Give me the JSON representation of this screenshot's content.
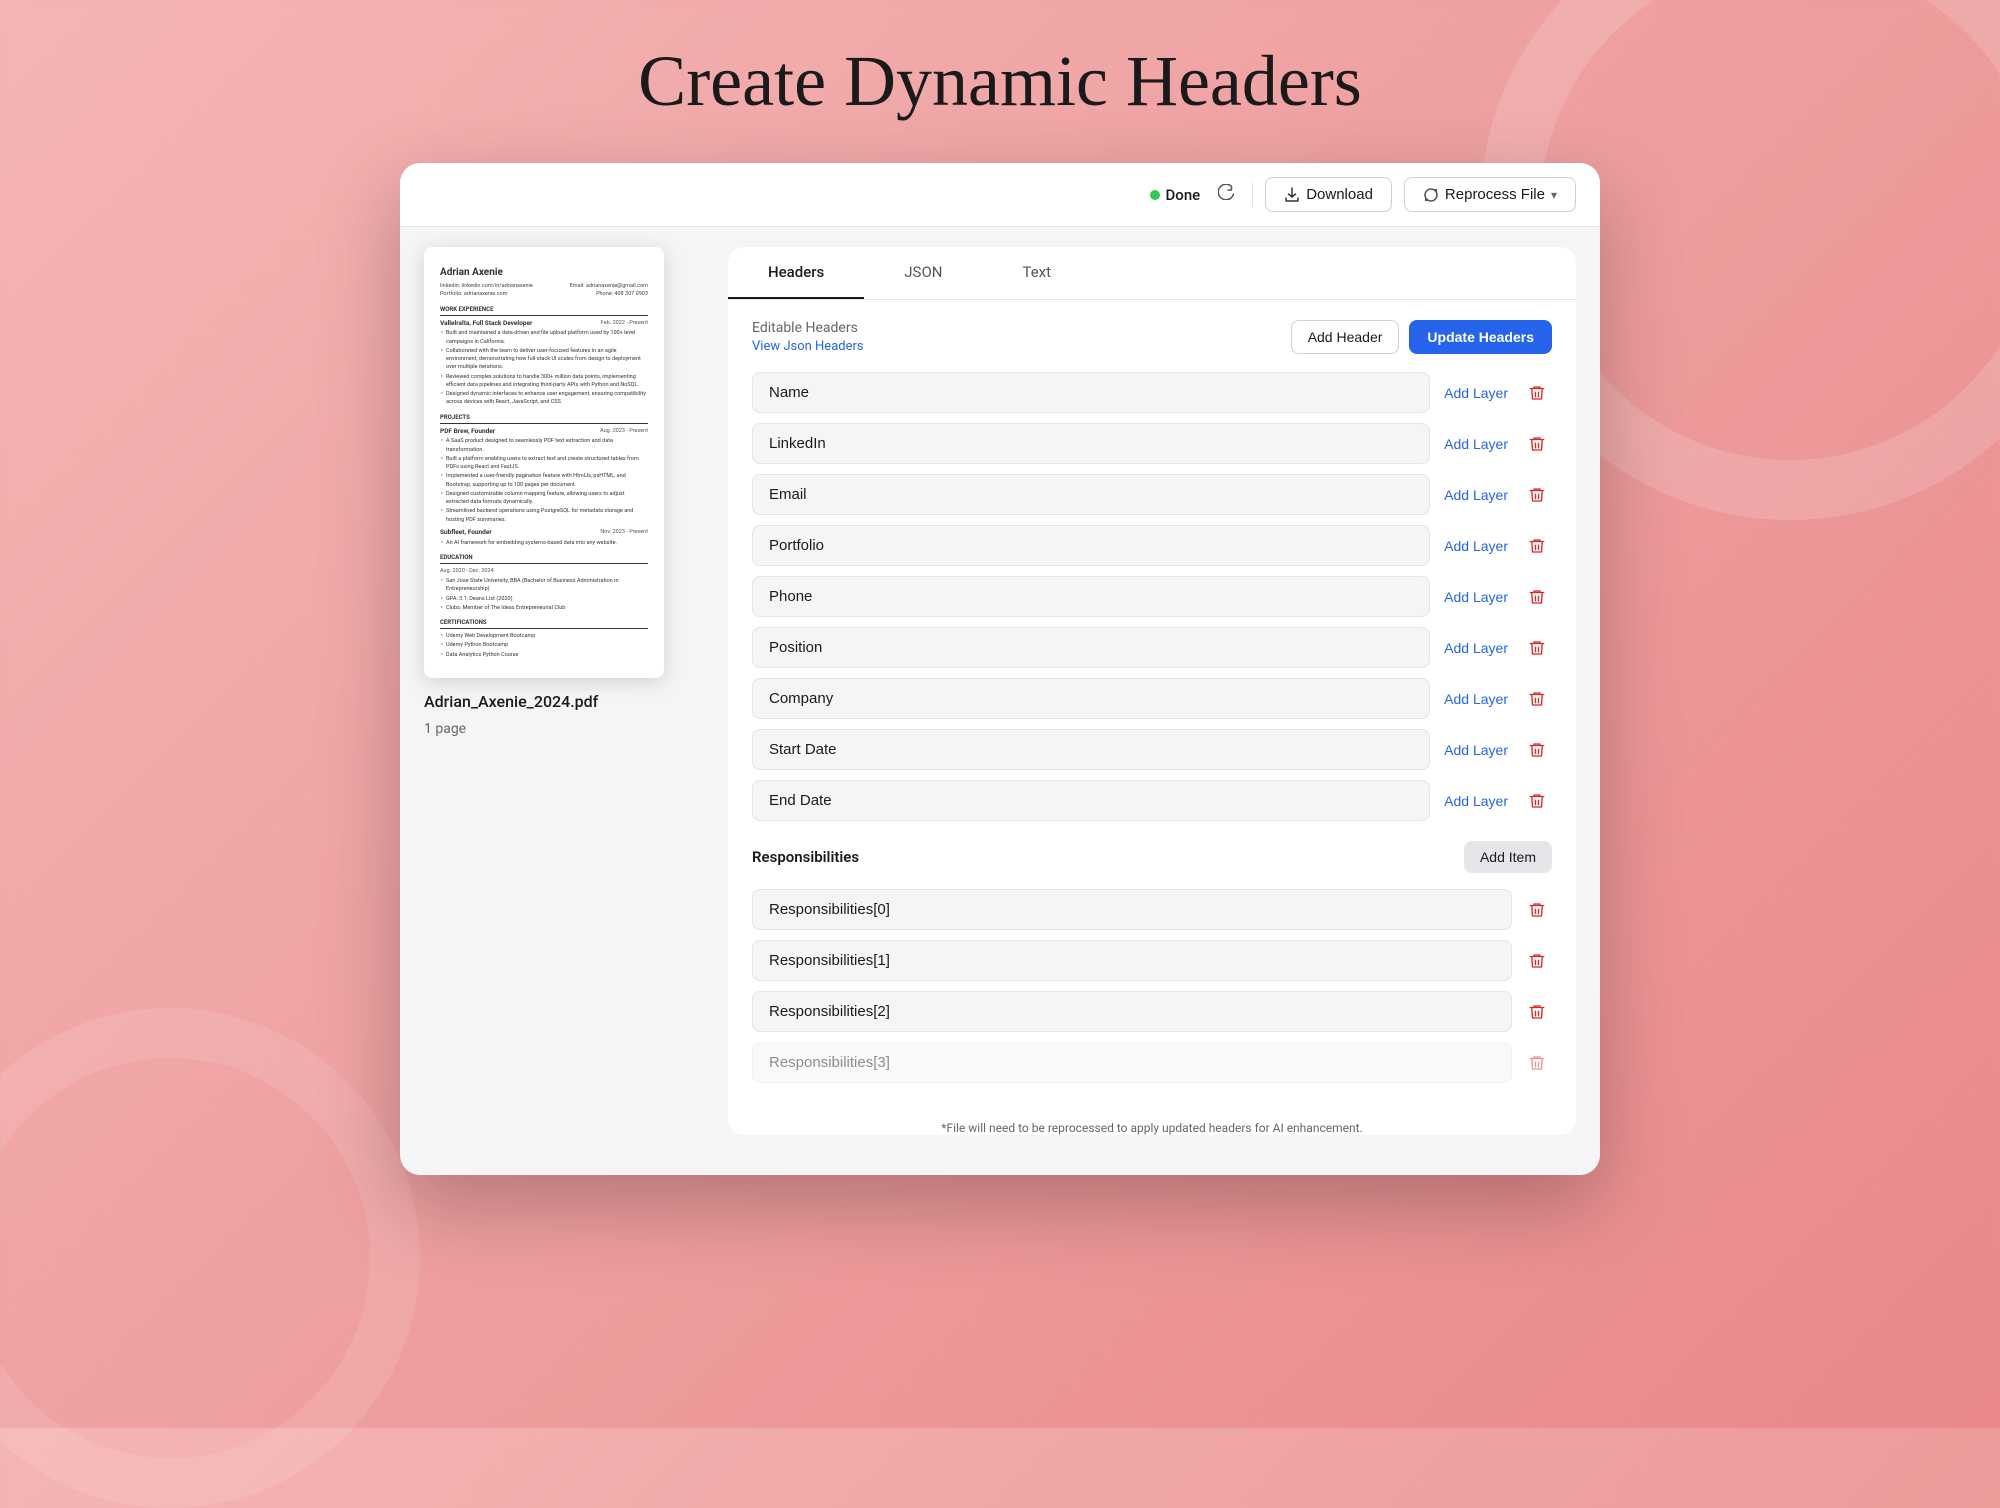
{
  "page": {
    "title": "Create Dynamic Headers"
  },
  "toolbar": {
    "status_label": "Done",
    "download_label": "Download",
    "reprocess_label": "Reprocess File"
  },
  "pdf": {
    "filename": "Adrian_Axenie_2024.pdf",
    "pages": "1 page",
    "preview": {
      "name": "Adrian Axenie",
      "linkedin": "linkedin: linkedin.com/in/adrianaxenie",
      "portfolio": "Portfolio: adrianaxenie.com",
      "email": "Email: adrianaxenie@gmail.com",
      "phone": "Phone: 408 307 0903",
      "work_section": "WORK EXPERIENCE",
      "job_title": "Vallelralta, Full Stack Developer",
      "date1": "Feb. 2022 - Present",
      "bullets": [
        "Built and maintained a data-driven and file upload platform used by 100+ level campaign in California.",
        "Collaborated with the team to deliver user-focused features in an agile environment, demonstrating how full-stack UI scales from design to deployment over multiple iterations.",
        "Reviewed complex solutions to handle 100+ million data points, implementing efficient data pipelines and integrating third-party APIs with Python and NoSQL.",
        "Designed dynamic interfaces to enhance user engagement, ensuring accessibility across devices with React, JavaScript, and CSS."
      ],
      "projects_section": "PROJECTS",
      "proj1_title": "PDF Brew, Founder",
      "proj1_date": "Aug. 2023 - Present",
      "education_section": "EDUCATION",
      "edu_date": "Aug. 2020 - Dec. 2024",
      "edu_text": "San Jose State University, BBA (Bachelor of Business Administration in Entrepreneurship)",
      "certifications_section": "CERTIFICATIONS"
    }
  },
  "tabs": [
    {
      "label": "Headers",
      "active": true
    },
    {
      "label": "JSON",
      "active": false
    },
    {
      "label": "Text",
      "active": false
    }
  ],
  "headers_panel": {
    "editable_label": "Editable Headers",
    "view_json_label": "View Json Headers",
    "add_header_label": "Add Header",
    "update_headers_label": "Update Headers",
    "fields": [
      {
        "value": "Name"
      },
      {
        "value": "LinkedIn"
      },
      {
        "value": "Email"
      },
      {
        "value": "Portfolio"
      },
      {
        "value": "Phone"
      },
      {
        "value": "Position"
      },
      {
        "value": "Company"
      },
      {
        "value": "Start Date"
      },
      {
        "value": "End Date"
      }
    ],
    "responsibilities_section": {
      "label": "Responsibilities",
      "add_item_label": "Add Item",
      "items": [
        {
          "value": "Responsibilities[0]"
        },
        {
          "value": "Responsibilities[1]"
        },
        {
          "value": "Responsibilities[2]"
        },
        {
          "value": "Responsibilities[3]"
        }
      ]
    },
    "footer_note": "*File will need to be reprocessed to apply updated headers for AI enhancement."
  }
}
